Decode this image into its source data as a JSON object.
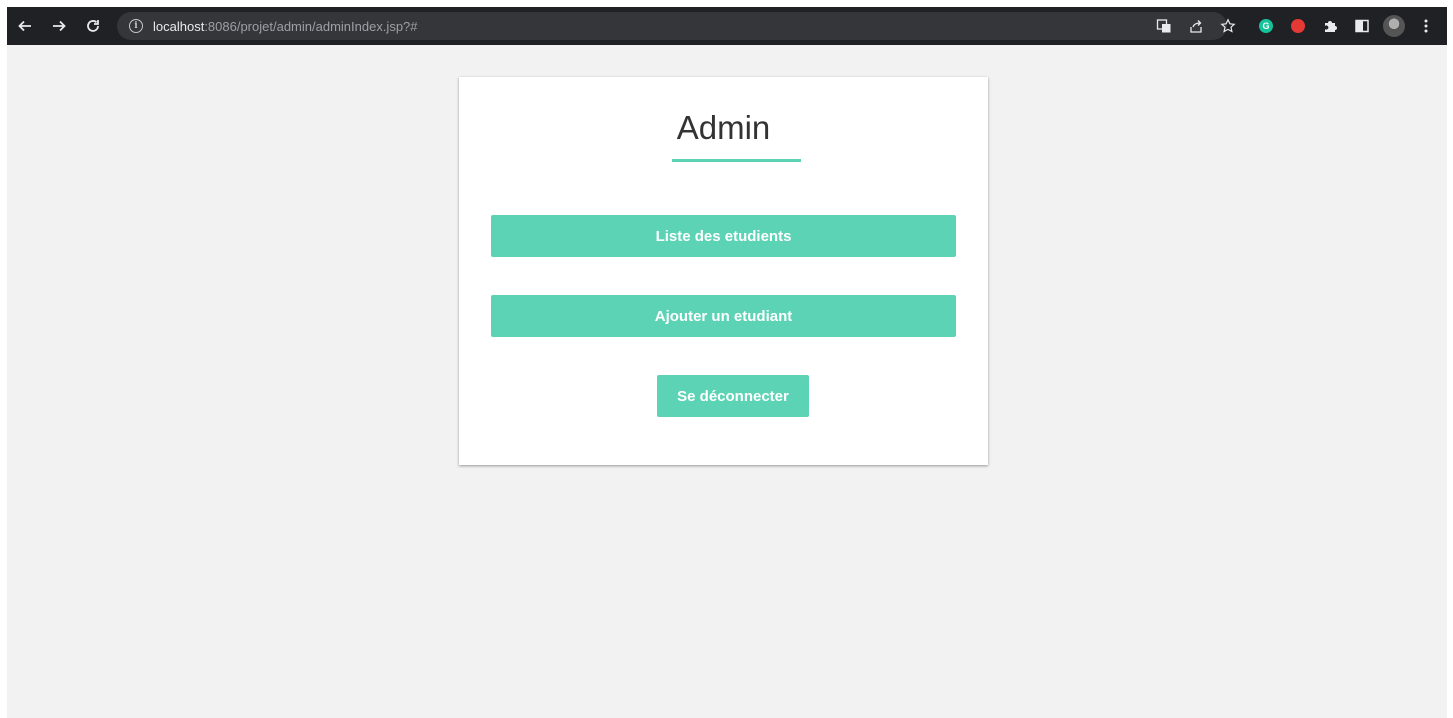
{
  "browser": {
    "url_host": "localhost",
    "url_rest": ":8086/projet/admin/adminIndex.jsp?#",
    "icons": {
      "back": "back-arrow-icon",
      "forward": "forward-arrow-icon",
      "reload": "reload-icon",
      "info": "info-icon",
      "translate": "translate-icon",
      "share": "share-icon",
      "bookmark": "star-icon",
      "grammarly": "grammarly-extension-icon",
      "ext_red": "red-extension-icon",
      "extensions": "puzzle-piece-icon",
      "side_panel": "side-panel-icon",
      "profile": "profile-avatar",
      "menu": "kebab-menu-icon"
    },
    "grammarly_letter": "G"
  },
  "page": {
    "title": "Admin",
    "buttons": {
      "list_students": "Liste des etudients",
      "add_student": "Ajouter un etudiant",
      "logout": "Se déconnecter"
    }
  },
  "colors": {
    "accent": "#5dd3b6",
    "page_bg": "#f2f2f2",
    "card_bg": "#ffffff",
    "toolbar_bg": "#202124"
  }
}
